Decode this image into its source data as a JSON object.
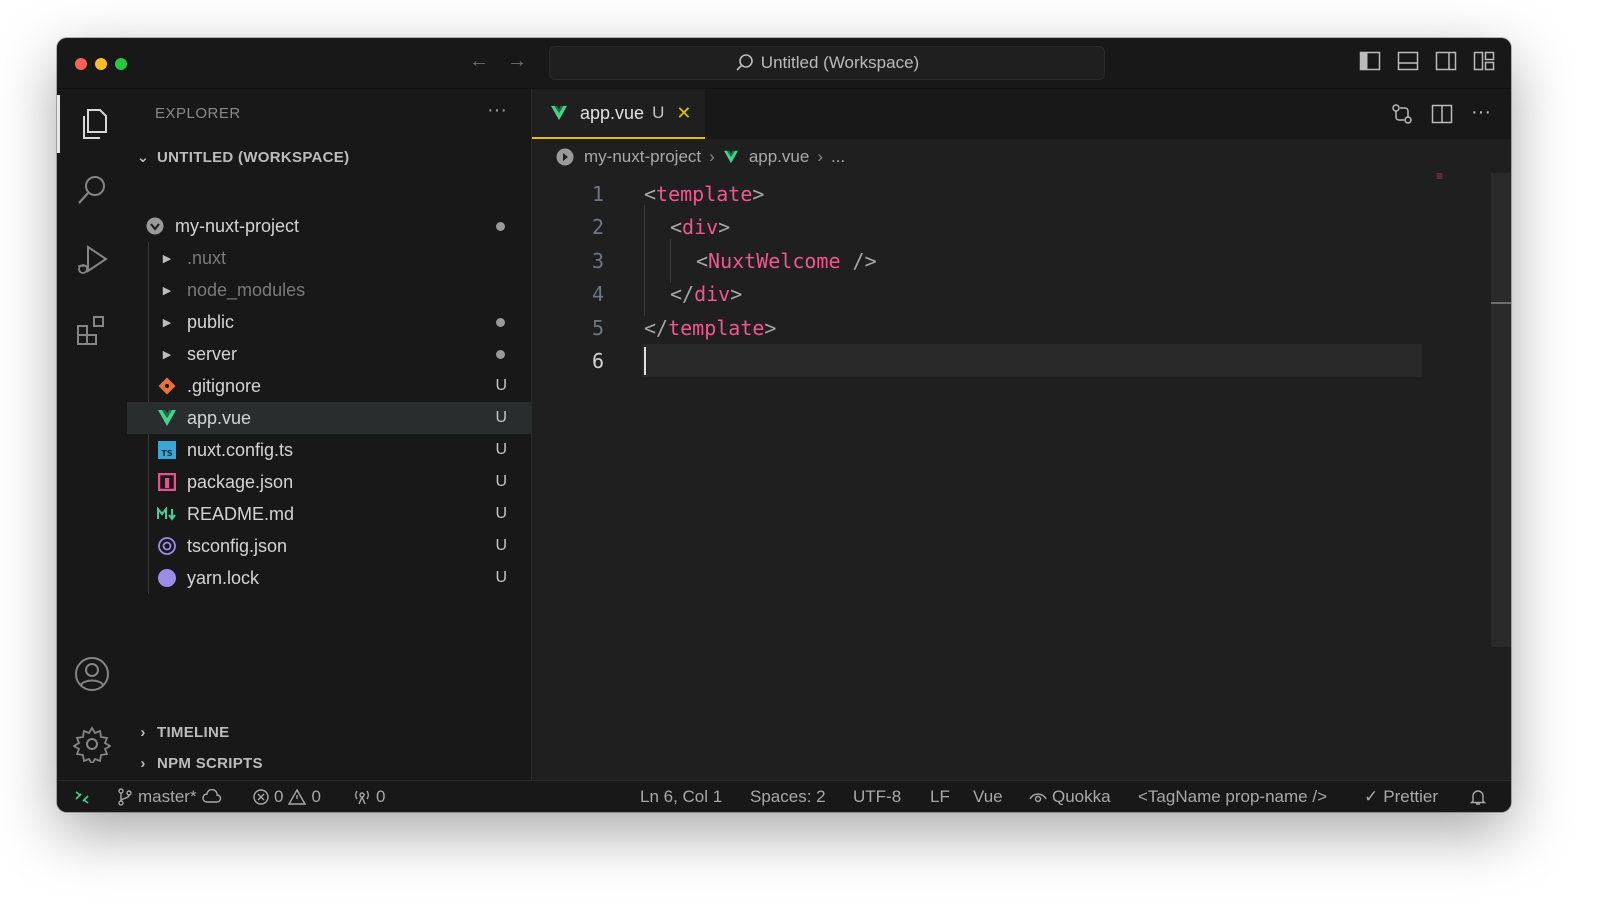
{
  "window": {
    "title": "Untitled (Workspace)"
  },
  "sidebar": {
    "title": "EXPLORER",
    "workspace_header": "UNTITLED (WORKSPACE)",
    "project": {
      "name": "my-nuxt-project"
    },
    "folders": [
      {
        "name": ".nuxt",
        "dimmed": true
      },
      {
        "name": "node_modules",
        "dimmed": true
      },
      {
        "name": "public",
        "modified_dot": true
      },
      {
        "name": "server",
        "modified_dot": true
      }
    ],
    "files": [
      {
        "name": ".gitignore",
        "status": "U",
        "icon": "git-icon"
      },
      {
        "name": "app.vue",
        "status": "U",
        "icon": "vue-icon"
      },
      {
        "name": "nuxt.config.ts",
        "status": "U",
        "icon": "typescript-icon"
      },
      {
        "name": "package.json",
        "status": "U",
        "icon": "npm-icon"
      },
      {
        "name": "README.md",
        "status": "U",
        "icon": "markdown-icon"
      },
      {
        "name": "tsconfig.json",
        "status": "U",
        "icon": "tsconfig-icon"
      },
      {
        "name": "yarn.lock",
        "status": "U",
        "icon": "yarn-icon"
      }
    ],
    "timeline": "TIMELINE",
    "npm_scripts": "NPM SCRIPTS"
  },
  "editor": {
    "tab": {
      "name": "app.vue",
      "status": "U"
    },
    "breadcrumb": {
      "project": "my-nuxt-project",
      "file": "app.vue",
      "more": "..."
    },
    "line_numbers": [
      "1",
      "2",
      "3",
      "4",
      "5",
      "6"
    ],
    "code": {
      "l1_open": "<",
      "l1_tag": "template",
      "l1_close": ">",
      "l2_open": "<",
      "l2_tag": "div",
      "l2_close": ">",
      "l3_open": "<",
      "l3_tag": "NuxtWelcome",
      "l3_close": " />",
      "l4_open": "</",
      "l4_tag": "div",
      "l4_close": ">",
      "l5_open": "</",
      "l5_tag": "template",
      "l5_close": ">"
    }
  },
  "statusbar": {
    "branch": "master*",
    "errors": "0",
    "warnings": "0",
    "ports": "0",
    "position": "Ln 6, Col 1",
    "spaces": "Spaces: 2",
    "encoding": "UTF-8",
    "eol": "LF",
    "language": "Vue",
    "quokka": "Quokka",
    "tagname": "<TagName prop-name />",
    "prettier": "Prettier"
  },
  "colors": {
    "accent_tab": "#e2c000",
    "tag": "#f0578f",
    "vue": "#41d48a"
  }
}
